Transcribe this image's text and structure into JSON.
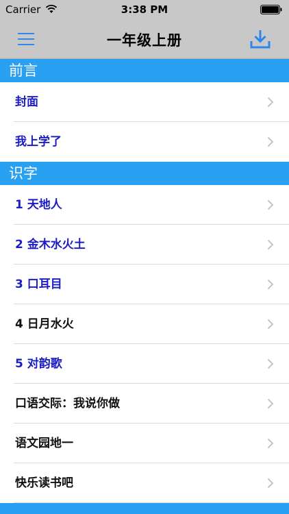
{
  "status_bar": {
    "carrier": "Carrier",
    "time": "3:38 PM"
  },
  "nav_bar": {
    "title": "一年级上册",
    "left_icon": "menu-icon",
    "right_icon": "download-icon",
    "accent_color": "#2f86ea"
  },
  "colors": {
    "section_header_bg": "#29a0f2",
    "link_text": "#1c1cc4",
    "plain_text": "#111111"
  },
  "sections": [
    {
      "title": "前言",
      "items": [
        {
          "label": "封面",
          "style": "blue"
        },
        {
          "label": "我上学了",
          "style": "blue"
        }
      ]
    },
    {
      "title": "识字",
      "items": [
        {
          "label": "1 天地人",
          "style": "blue"
        },
        {
          "label": "2 金木水火土",
          "style": "blue"
        },
        {
          "label": "3 口耳目",
          "style": "blue"
        },
        {
          "label": "4 日月水火",
          "style": "black"
        },
        {
          "label": "5 对韵歌",
          "style": "blue"
        },
        {
          "label": "口语交际：我说你做",
          "style": "black"
        },
        {
          "label": "语文园地一",
          "style": "black"
        },
        {
          "label": "快乐读书吧",
          "style": "black"
        }
      ]
    }
  ]
}
